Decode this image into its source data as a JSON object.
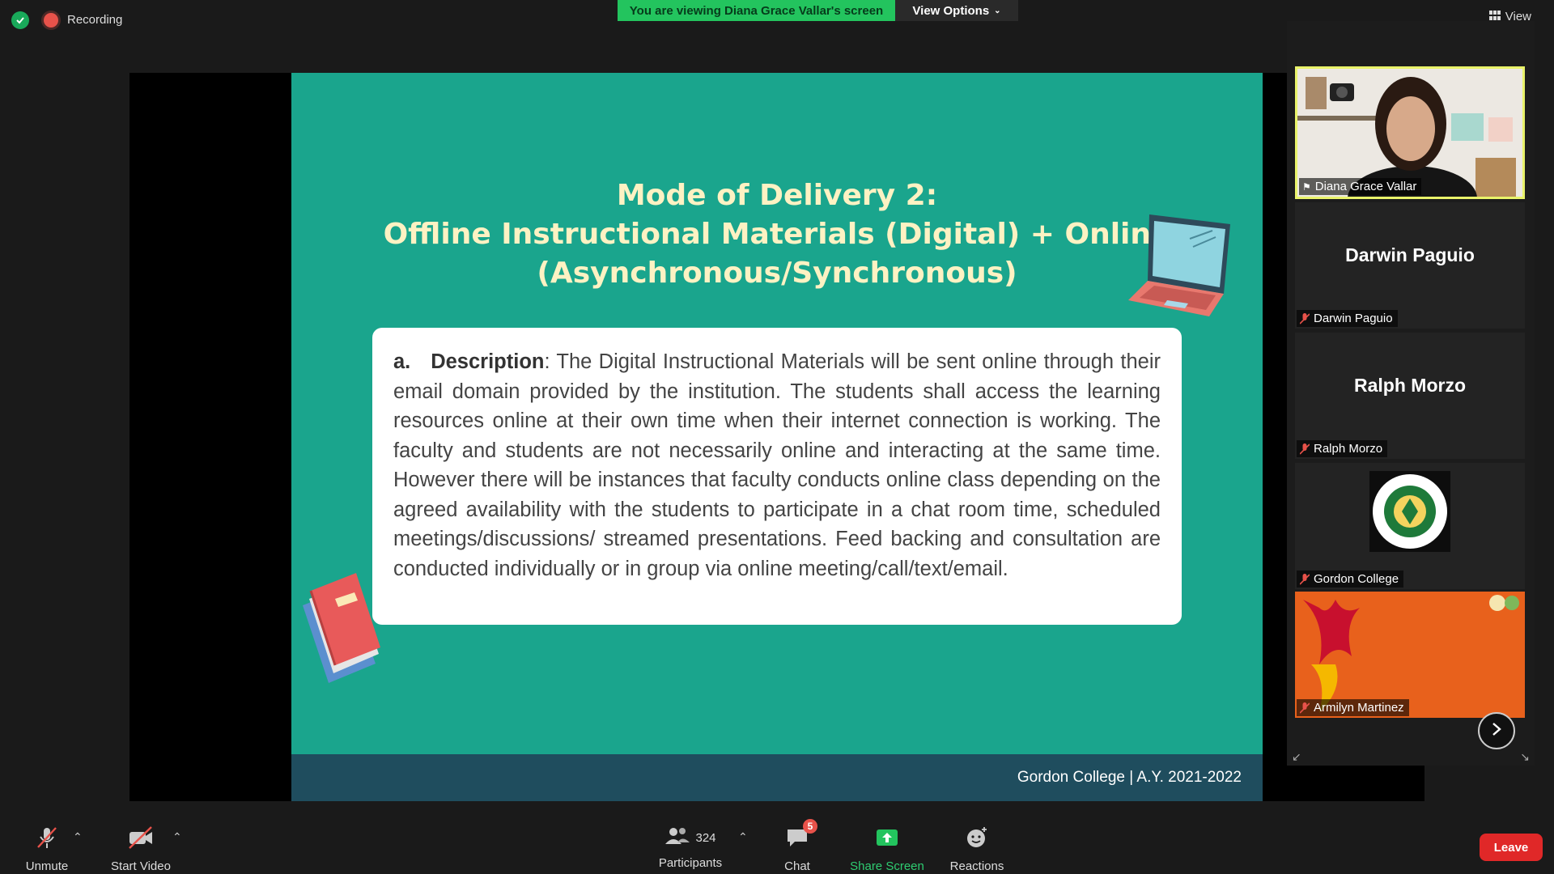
{
  "top_bar": {
    "recording_label": "Recording",
    "viewing_banner": "You are viewing Diana Grace Vallar's screen",
    "view_options_label": "View Options",
    "view_label": "View"
  },
  "slide": {
    "title_lines": [
      "Mode of Delivery 2:",
      "Offline Instructional Materials (Digital) + Online",
      "(Asynchronous/Synchronous)"
    ],
    "item_marker": "a.",
    "item_heading": "Description",
    "description_text": ": The Digital Instructional Materials will be sent online through their email domain provided by the institution. The students shall access the learning resources online at their own time when their internet connection is working. The faculty and students are not necessarily online and interacting at the same time. However there will be instances that faculty conducts online class depending on the agreed availability with the students to participate in a chat room time, scheduled meetings/discussions/ streamed presentations. Feed backing and consultation are conducted individually or in group via online meeting/call/text/email.",
    "footer": "Gordon College | A.Y. 2021-2022"
  },
  "participants_panel": {
    "tiles": [
      {
        "name": "Diana Grace Vallar",
        "kind": "video",
        "active": true
      },
      {
        "name": "Darwin Paguio",
        "display_name": "Darwin Paguio",
        "kind": "name",
        "muted": true
      },
      {
        "name": "Ralph Morzo",
        "display_name": "Ralph Morzo",
        "kind": "name",
        "muted": true
      },
      {
        "name": "Gordon College",
        "kind": "logo",
        "muted": true
      },
      {
        "name": "Armilyn Martinez",
        "kind": "image",
        "muted": true
      }
    ]
  },
  "toolbar": {
    "unmute_label": "Unmute",
    "start_video_label": "Start Video",
    "participants_label": "Participants",
    "participants_count": "324",
    "chat_label": "Chat",
    "chat_badge": "5",
    "share_screen_label": "Share Screen",
    "reactions_label": "Reactions",
    "leave_label": "Leave"
  },
  "colors": {
    "slide_bg": "#1aa58d",
    "slide_footer": "#1f4d5e",
    "title_text": "#fdf2c3",
    "banner_green": "#23c45e",
    "leave_red": "#e02828",
    "active_speaker_border": "#e9f36a"
  }
}
